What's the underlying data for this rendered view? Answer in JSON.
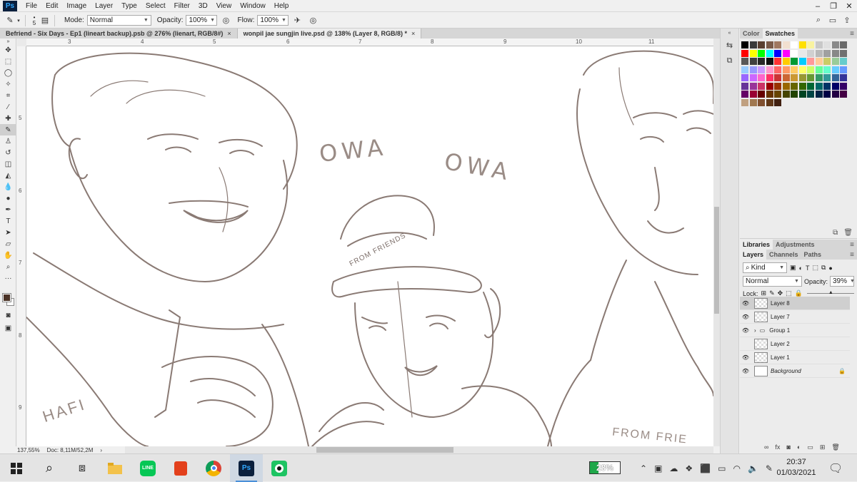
{
  "menubar": {
    "logo": "Ps",
    "items": [
      "File",
      "Edit",
      "Image",
      "Layer",
      "Type",
      "Select",
      "Filter",
      "3D",
      "View",
      "Window",
      "Help"
    ]
  },
  "options": {
    "brush_size": "5",
    "mode_label": "Mode:",
    "mode_value": "Normal",
    "opacity_label": "Opacity:",
    "opacity_value": "100%",
    "flow_label": "Flow:",
    "flow_value": "100%"
  },
  "tabs": [
    {
      "label": "Befriend - Six Days - Ep1 (lineart backup).psb @ 276% (lienart, RGB/8#)",
      "close": "×"
    },
    {
      "label": "wonpil jae sungjin live.psd @ 138% (Layer 8, RGB/8) *",
      "close": "×"
    }
  ],
  "rulers": {
    "top": [
      "3",
      "4",
      "5",
      "6",
      "7",
      "8",
      "9",
      "10",
      "11"
    ],
    "left": [
      "5",
      "6",
      "7",
      "8",
      "9"
    ]
  },
  "artwork": {
    "text1": "OWA",
    "text2": "OWA",
    "cap_text": "FROM FRIENDS",
    "signature": "HAFI",
    "shirt_text": "FROM FRIE"
  },
  "status": {
    "zoom": "137,55%",
    "doc": "Doc: 8,11M/52,2M"
  },
  "color_panel": {
    "tabs": [
      "Color",
      "Swatches"
    ],
    "active_tab": "Swatches"
  },
  "swatches": [
    "#000000",
    "#3a3a3a",
    "#5a3f30",
    "#7a5a48",
    "#a07860",
    "#f2e0d0",
    "#ffffff",
    "#ffe000",
    "#f9f3a0",
    "#c8c8c8",
    "#e0e0e0",
    "#8a8a8a",
    "#6a6a6a",
    "#ff0000",
    "#ffff00",
    "#00ff00",
    "#00ffff",
    "#0000ff",
    "#ff00ff",
    "#ffffff",
    "#e8e8e8",
    "#d0d0d0",
    "#b8b8b8",
    "#a0a0a0",
    "#888888",
    "#707070",
    "#585858",
    "#404040",
    "#282828",
    "#101010",
    "#ff3333",
    "#ffcc00",
    "#009933",
    "#00ccff",
    "#ff9999",
    "#ffcc99",
    "#cccc66",
    "#99cc99",
    "#66cccc",
    "#99ccff",
    "#9999ff",
    "#cc99ff",
    "#ff99cc",
    "#ff6666",
    "#ff9966",
    "#ffcc66",
    "#ffff66",
    "#ccff66",
    "#66ff99",
    "#66ffcc",
    "#66ccff",
    "#6699ff",
    "#9966ff",
    "#cc66ff",
    "#ff66cc",
    "#ff3366",
    "#cc3333",
    "#cc6633",
    "#cc9933",
    "#999933",
    "#669933",
    "#339966",
    "#339999",
    "#336699",
    "#333399",
    "#663399",
    "#993399",
    "#cc3366",
    "#990000",
    "#993300",
    "#996600",
    "#666600",
    "#336600",
    "#006633",
    "#006666",
    "#003366",
    "#000066",
    "#330066",
    "#660066",
    "#990033",
    "#660000",
    "#663300",
    "#664400",
    "#444400",
    "#224400",
    "#004422",
    "#004444",
    "#002244",
    "#000044",
    "#220044",
    "#440044",
    "#c0a080",
    "#a07850",
    "#805030",
    "#603818",
    "#402010"
  ],
  "panel2": {
    "tabs": [
      "Libraries",
      "Adjustments"
    ]
  },
  "layers_panel": {
    "tabs": [
      "Layers",
      "Channels",
      "Paths"
    ],
    "filter": "Kind",
    "blend": "Normal",
    "opacity_label": "Opacity:",
    "opacity_value": "39%",
    "lock_label": "Lock:",
    "layers": [
      {
        "name": "Layer 8",
        "visible": true,
        "selected": true
      },
      {
        "name": "Layer 7",
        "visible": true,
        "selected": false
      },
      {
        "name": "Group 1",
        "visible": true,
        "selected": false,
        "group": true
      },
      {
        "name": "Layer 2",
        "visible": false,
        "selected": false
      },
      {
        "name": "Layer 1",
        "visible": true,
        "selected": false
      },
      {
        "name": "Background",
        "visible": true,
        "selected": false,
        "background": true
      }
    ]
  },
  "taskbar": {
    "battery": "28%",
    "battery_level": 0.28,
    "time": "20:37",
    "date": "01/03/2021"
  }
}
